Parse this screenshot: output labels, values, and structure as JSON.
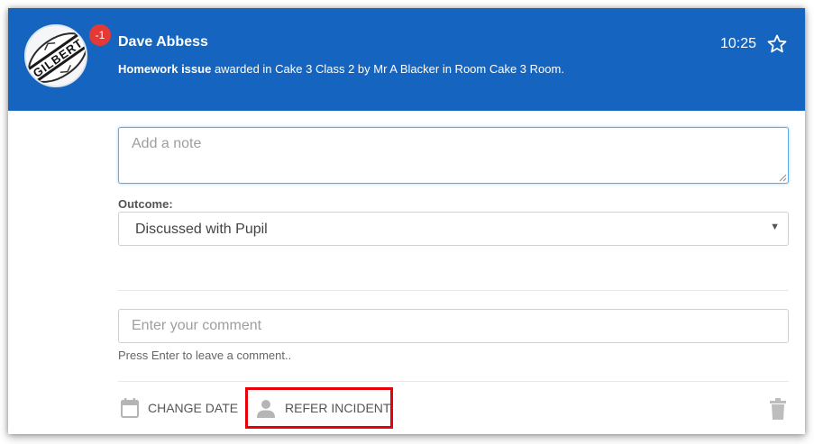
{
  "header": {
    "sender_name": "Dave Abbess",
    "badge_count": "-1",
    "time": "10:25",
    "description_bold": "Homework issue",
    "description_rest": " awarded in Cake 3 Class 2 by Mr A Blacker in Room Cake 3 Room.",
    "avatar_icon": "rugby-ball-avatar",
    "avatar_text": "GILBERT",
    "star_icon": "star-outline-icon",
    "background_color": "#1565c0",
    "badge_color": "#e53935"
  },
  "note": {
    "placeholder": "Add a note",
    "value": ""
  },
  "outcome": {
    "label": "Outcome:",
    "selected": "Discussed with Pupil"
  },
  "comment": {
    "placeholder": "Enter your comment",
    "value": "",
    "hint": "Press Enter to leave a comment.."
  },
  "actions": {
    "change_date_label": "CHANGE DATE",
    "change_date_icon": "calendar-icon",
    "refer_incident_label": "REFER INCIDENT",
    "refer_incident_icon": "person-icon",
    "delete_icon": "trash-icon",
    "highlight_color": "#e8000b"
  }
}
